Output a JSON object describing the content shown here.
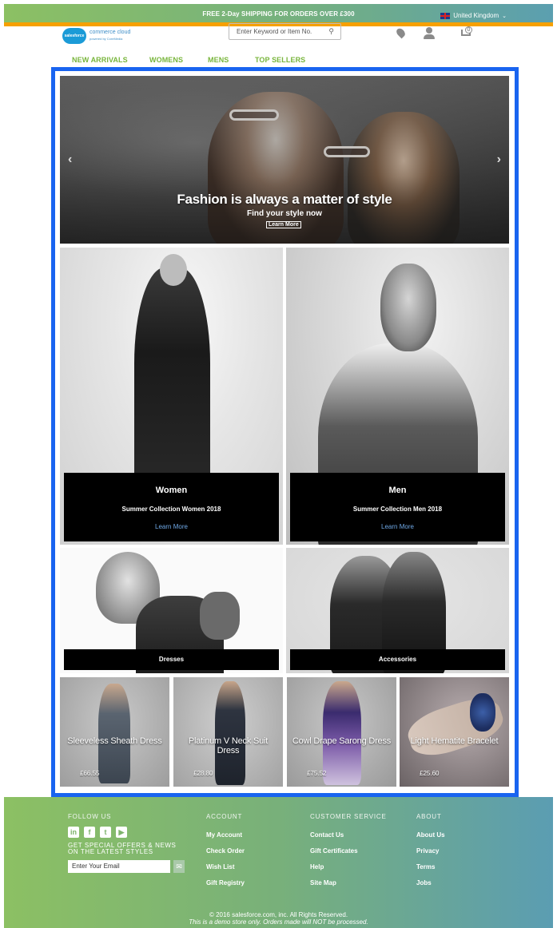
{
  "promo": {
    "text": "FREE 2-Day SHIPPING FOR ORDERS OVER £300",
    "country": "United Kingdom"
  },
  "brand": {
    "logo_badge": "salesforce",
    "name": "commerce cloud",
    "tagline": "powered by CoreMedia"
  },
  "search": {
    "placeholder": "Enter Keyword or Item No."
  },
  "cart": {
    "count": "0"
  },
  "nav": [
    "NEW ARRIVALS",
    "WOMENS",
    "MENS",
    "TOP SELLERS"
  ],
  "hero": {
    "title": "Fashion is always a matter of style",
    "subtitle": "Find your style now",
    "button": "Learn More"
  },
  "categories": {
    "women": {
      "title": "Women",
      "subtitle": "Summer Collection Women 2018",
      "link": "Learn More"
    },
    "men": {
      "title": "Men",
      "subtitle": "Summer Collection Men 2018",
      "link": "Learn More"
    },
    "dresses": {
      "label": "Dresses"
    },
    "accessories": {
      "label": "Accessories"
    }
  },
  "products": [
    {
      "name": "Sleeveless Sheath Dress",
      "price": "£66.55"
    },
    {
      "name": "Platinum V Neck Suit Dress",
      "price": "£28.80"
    },
    {
      "name": "Cowl Drape Sarong Dress",
      "price": "£75.52"
    },
    {
      "name": "Light Hematite Bracelet",
      "price": "£25.60"
    }
  ],
  "footer": {
    "follow": {
      "heading": "FOLLOW US",
      "icons": [
        "linkedin-icon",
        "facebook-icon",
        "twitter-icon",
        "youtube-icon"
      ],
      "offers": "GET SPECIAL OFFERS & NEWS ON THE LATEST STYLES",
      "email_placeholder": "Enter Your Email"
    },
    "account": {
      "heading": "ACCOUNT",
      "links": [
        "My Account",
        "Check Order",
        "Wish List",
        "Gift Registry"
      ]
    },
    "service": {
      "heading": "CUSTOMER SERVICE",
      "links": [
        "Contact Us",
        "Gift Certificates",
        "Help",
        "Site Map"
      ]
    },
    "about": {
      "heading": "ABOUT",
      "links": [
        "About Us",
        "Privacy",
        "Terms",
        "Jobs"
      ]
    },
    "copyright": "© 2016 salesforce.com, inc. All Rights Reserved.",
    "demo_notice": "This is a demo store only. Orders made will NOT be processed."
  },
  "colors": {
    "nav_green": "#78b53b",
    "frame_blue": "#1964f0",
    "promo_border": "#f6a000"
  }
}
